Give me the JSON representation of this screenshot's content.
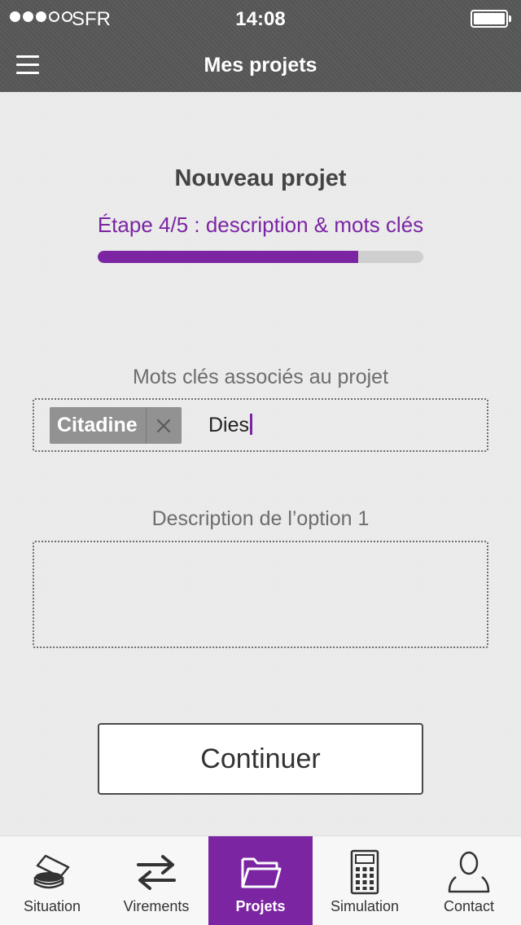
{
  "status_bar": {
    "carrier": "SFR",
    "time": "14:08",
    "signal_bars_filled": 3,
    "signal_bars_total": 5,
    "battery_icon": "battery-icon"
  },
  "nav_bar": {
    "title": "Mes projets",
    "menu_icon": "hamburger-menu-icon"
  },
  "main": {
    "heading": "Nouveau projet",
    "step_label": "Étape 4/5 : description & mots clés",
    "progress_fraction": 0.8,
    "keywords": {
      "label": "Mots clés associés au projet",
      "tags": [
        {
          "label": "Citadine",
          "remove_icon": "close-icon"
        }
      ],
      "input_value": "Dies"
    },
    "description": {
      "label": "Description de l’option 1",
      "value": ""
    },
    "continue_label": "Continuer"
  },
  "tab_bar": {
    "active_index": 2,
    "tabs": [
      {
        "label": "Situation",
        "icon": "coins-icon"
      },
      {
        "label": "Virements",
        "icon": "transfer-arrows-icon"
      },
      {
        "label": "Projets",
        "icon": "folder-icon"
      },
      {
        "label": "Simulation",
        "icon": "calculator-icon"
      },
      {
        "label": "Contact",
        "icon": "user-icon"
      }
    ]
  },
  "colors": {
    "accent": "#7b25a3",
    "top_bar": "#575757",
    "background": "#ececec"
  }
}
